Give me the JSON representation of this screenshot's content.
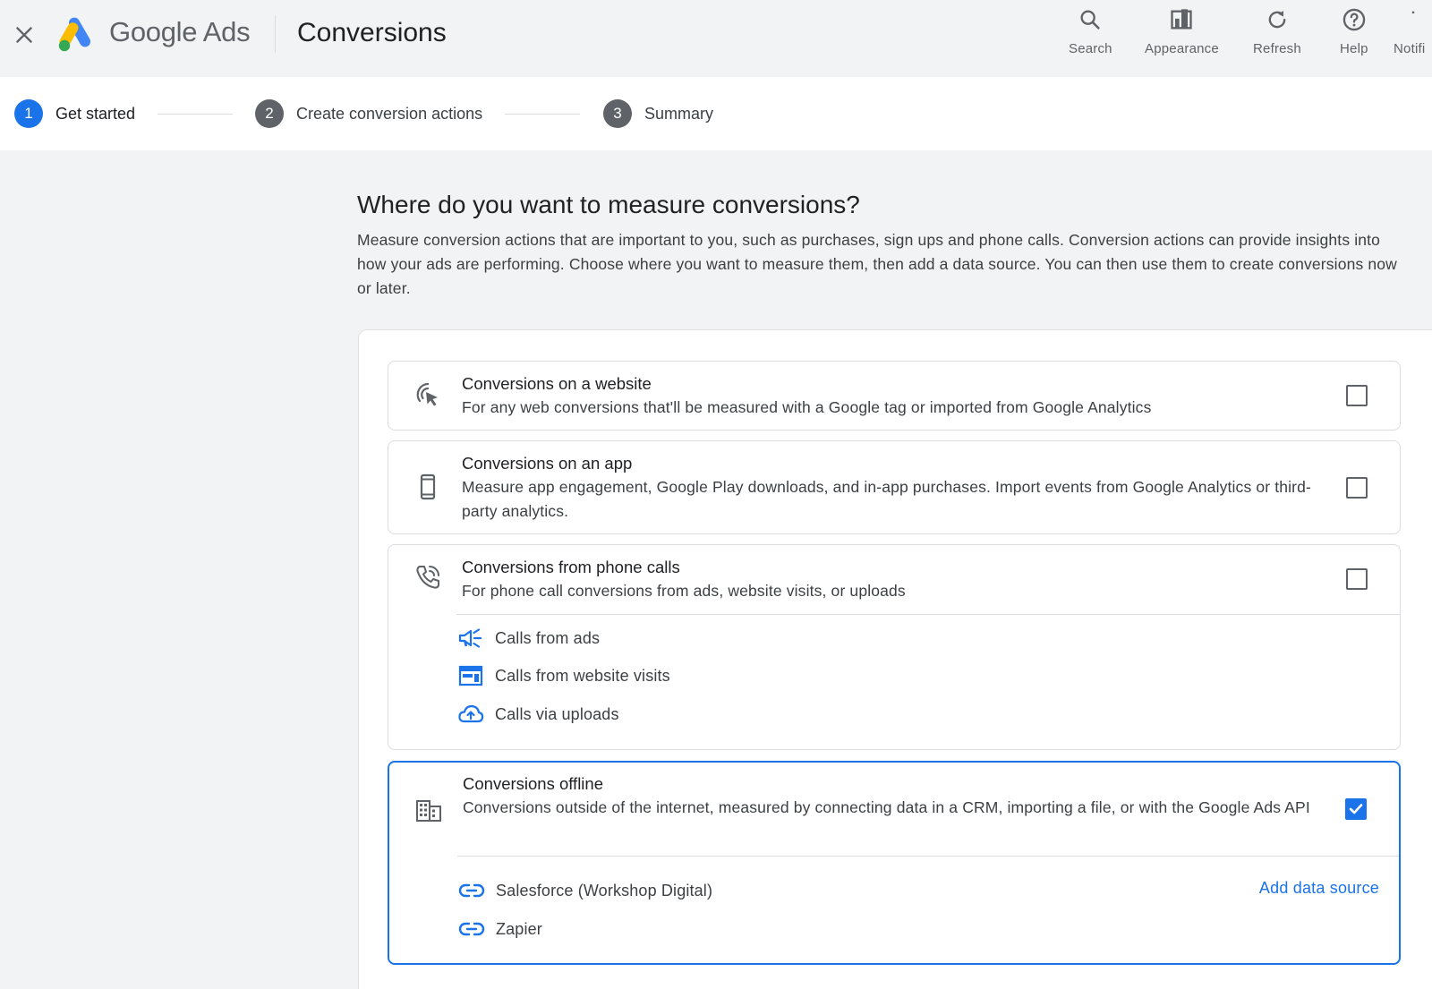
{
  "header": {
    "brand_google": "Google",
    "brand_ads": "Ads",
    "title": "Conversions",
    "tools": [
      {
        "label": "Search",
        "icon": "search-icon"
      },
      {
        "label": "Appearance",
        "icon": "appearance-icon"
      },
      {
        "label": "Refresh",
        "icon": "refresh-icon"
      },
      {
        "label": "Help",
        "icon": "help-icon"
      },
      {
        "label": "Notifi",
        "icon": "notifications-icon"
      }
    ]
  },
  "stepper": {
    "steps": [
      {
        "number": "1",
        "label": "Get started",
        "active": true
      },
      {
        "number": "2",
        "label": "Create conversion actions",
        "active": false
      },
      {
        "number": "3",
        "label": "Summary",
        "active": false
      }
    ]
  },
  "main": {
    "heading": "Where do you want to measure conversions?",
    "description": "Measure conversion actions that are important to you, such as purchases, sign ups and phone calls. Conversion actions can provide insights into how your ads are performing. Choose where you want to measure them, then add a data source. You can then use them to create conversions now or later.",
    "options": [
      {
        "title": "Conversions on a website",
        "description": "For any web conversions that'll be measured with a Google tag or imported from Google Analytics",
        "checked": false
      },
      {
        "title": "Conversions on an app",
        "description": "Measure app engagement, Google Play downloads, and in-app purchases. Import events from Google Analytics or third-party analytics.",
        "checked": false
      },
      {
        "title": "Conversions from phone calls",
        "description": "For phone call conversions from ads, website visits, or uploads",
        "checked": false,
        "sub_items": [
          "Calls from ads",
          "Calls from website visits",
          "Calls via uploads"
        ]
      },
      {
        "title": "Conversions offline",
        "description": "Conversions outside of the internet, measured by connecting data in a CRM, importing a file, or with the Google Ads API",
        "checked": true,
        "sources": [
          "Salesforce (Workshop Digital)",
          "Zapier"
        ],
        "add_source_label": "Add data source"
      }
    ]
  },
  "colors": {
    "accent": "#1a73e8",
    "background": "#f1f3f4",
    "text": "#202124",
    "secondary_text": "#3c4043"
  }
}
